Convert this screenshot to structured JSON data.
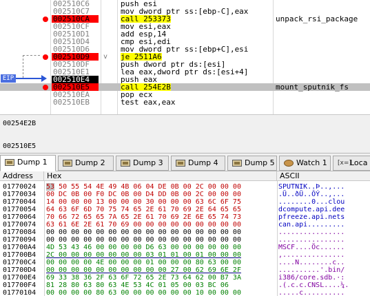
{
  "disasm": {
    "rows": [
      {
        "addr": "002510C6",
        "instr": "push esi",
        "comment": "",
        "bp": false,
        "style": "normal",
        "mark": ""
      },
      {
        "addr": "002510C7",
        "instr": "mov dword ptr ss:[ebp-C],eax",
        "comment": "",
        "bp": false,
        "style": "normal",
        "mark": ""
      },
      {
        "addr": "002510CA",
        "instr": "call 253373",
        "comment": "unpack_rsi_package",
        "bp": true,
        "style": "red",
        "mark": ""
      },
      {
        "addr": "002510CF",
        "instr": "mov esi,eax",
        "comment": "",
        "bp": false,
        "style": "normal",
        "mark": ""
      },
      {
        "addr": "002510D1",
        "instr": "add esp,14",
        "comment": "",
        "bp": false,
        "style": "normal",
        "mark": ""
      },
      {
        "addr": "002510D4",
        "instr": "cmp esi,edi",
        "comment": "",
        "bp": false,
        "style": "normal",
        "mark": ""
      },
      {
        "addr": "002510D6",
        "instr": "mov dword ptr ss:[ebp+C],esi",
        "comment": "",
        "bp": false,
        "style": "normal",
        "mark": ""
      },
      {
        "addr": "002510D9",
        "instr": "je 2511A6",
        "comment": "",
        "bp": true,
        "style": "red",
        "mark": "v"
      },
      {
        "addr": "002510DF",
        "instr": "push dword ptr ds:[esi]",
        "comment": "",
        "bp": false,
        "style": "normal",
        "mark": ""
      },
      {
        "addr": "002510E1",
        "instr": "lea eax,dword ptr ds:[esi+4]",
        "comment": "",
        "bp": false,
        "style": "normal",
        "mark": ""
      },
      {
        "addr": "002510E4",
        "instr": "push eax",
        "comment": "",
        "bp": false,
        "style": "eip",
        "mark": ""
      },
      {
        "addr": "002510E5",
        "instr": "call 254E2B",
        "comment": "mount_sputnik_fs",
        "bp": true,
        "style": "red-selected",
        "mark": ""
      },
      {
        "addr": "002510EA",
        "instr": "pop ecx",
        "comment": "",
        "bp": false,
        "style": "normal",
        "mark": ""
      },
      {
        "addr": "002510EB",
        "instr": "test eax,eax",
        "comment": "",
        "bp": false,
        "style": "normal",
        "mark": ""
      }
    ],
    "eip_label": "EIP"
  },
  "info": {
    "line1": "00254E2B",
    "line2": "002510E5"
  },
  "tabs": [
    {
      "label": "Dump 1",
      "icon": "memory-icon",
      "active": true
    },
    {
      "label": "Dump 2",
      "icon": "memory-icon",
      "active": false
    },
    {
      "label": "Dump 3",
      "icon": "memory-icon",
      "active": false
    },
    {
      "label": "Dump 4",
      "icon": "memory-icon",
      "active": false
    },
    {
      "label": "Dump 5",
      "icon": "memory-icon",
      "active": false
    },
    {
      "label": "Watch 1",
      "icon": "owl-icon",
      "active": false
    },
    {
      "label": "Loca",
      "icon": "locals-icon",
      "active": false
    }
  ],
  "locals_icon_text": "[x=]",
  "dump": {
    "headers": {
      "address": "Address",
      "hex": "Hex",
      "ascii": "ASCII"
    },
    "rows": [
      {
        "addr": "01770024",
        "hex": "53 50 55 54 4E 49 4B 06 04 DE 0B 00 2C 00 00 00",
        "ascii": "SPUTNIK..Þ..,..."
      },
      {
        "addr": "01770034",
        "hex": "00 DC 0B 00 F0 DC 0B 00 D4 DD 0B 00 2C 00 00 00",
        "ascii": ".Ü..ðÜ..ÔÝ..,..."
      },
      {
        "addr": "01770044",
        "hex": "14 00 00 00 13 00 00 00 30 00 00 00 63 6C 6F 75",
        "ascii": "........0...clou"
      },
      {
        "addr": "01770054",
        "hex": "64 63 6F 6D 70 75 74 65 2E 61 70 69 2E 64 65 65",
        "ascii": "dcompute.api.dee"
      },
      {
        "addr": "01770064",
        "hex": "70 66 72 65 65 7A 65 2E 61 70 69 2E 6E 65 74 73",
        "ascii": "pfreeze.api.nets"
      },
      {
        "addr": "01770074",
        "hex": "63 61 6E 2E 61 70 69 00 00 00 00 00 00 00 00 00",
        "ascii": "can.api........."
      },
      {
        "addr": "01770084",
        "hex": "00 00 00 00 00 00 00 00 00 00 00 00 00 00 00 00",
        "ascii": "................"
      },
      {
        "addr": "01770094",
        "hex": "00 00 00 00 00 00 00 00 00 00 00 00 00 00 00 00",
        "ascii": "................"
      },
      {
        "addr": "017700A4",
        "hex": "4D 53 43 46 00 00 00 00 D6 63 00 00 00 00 00 00",
        "ascii": "MSCF....Öc......"
      },
      {
        "addr": "017700B4",
        "hex": "2C 00 00 00 00 00 00 00 03 01 01 00 01 00 00 00",
        "ascii": ",..............."
      },
      {
        "addr": "017700C4",
        "hex": "00 00 00 00 4E 00 00 00 01 00 00 00 80 63 00 00",
        "ascii": "....N........c.."
      },
      {
        "addr": "017700D4",
        "hex": "00 00 00 00 00 00 00 00 00 00 27 00 62 69 6E 2F",
        "ascii": "..........'.bin/"
      },
      {
        "addr": "017700E4",
        "hex": "69 33 38 36 2F 63 6F 72 65 2E 73 64 62 00 B7 3A",
        "ascii": "i386/core.sdb.·:"
      },
      {
        "addr": "017700F4",
        "hex": "81 28 80 63 80 63 4E 53 4C 01 05 00 03 BC 06",
        "ascii": ".(.c.c.CNSL....¼."
      },
      {
        "addr": "01770104",
        "hex": "00 00 00 00 80 63 00 00 00 00 00 00 10 00 00 00",
        "ascii": ".....c.........."
      }
    ]
  },
  "colors": {
    "breakpoint_red": "#ff0000",
    "eip_row_bg": "#000000",
    "selected_row_bg": "#c0c0c0",
    "call_highlight": "#ffff00",
    "eip_blue": "#4a6ee0"
  }
}
